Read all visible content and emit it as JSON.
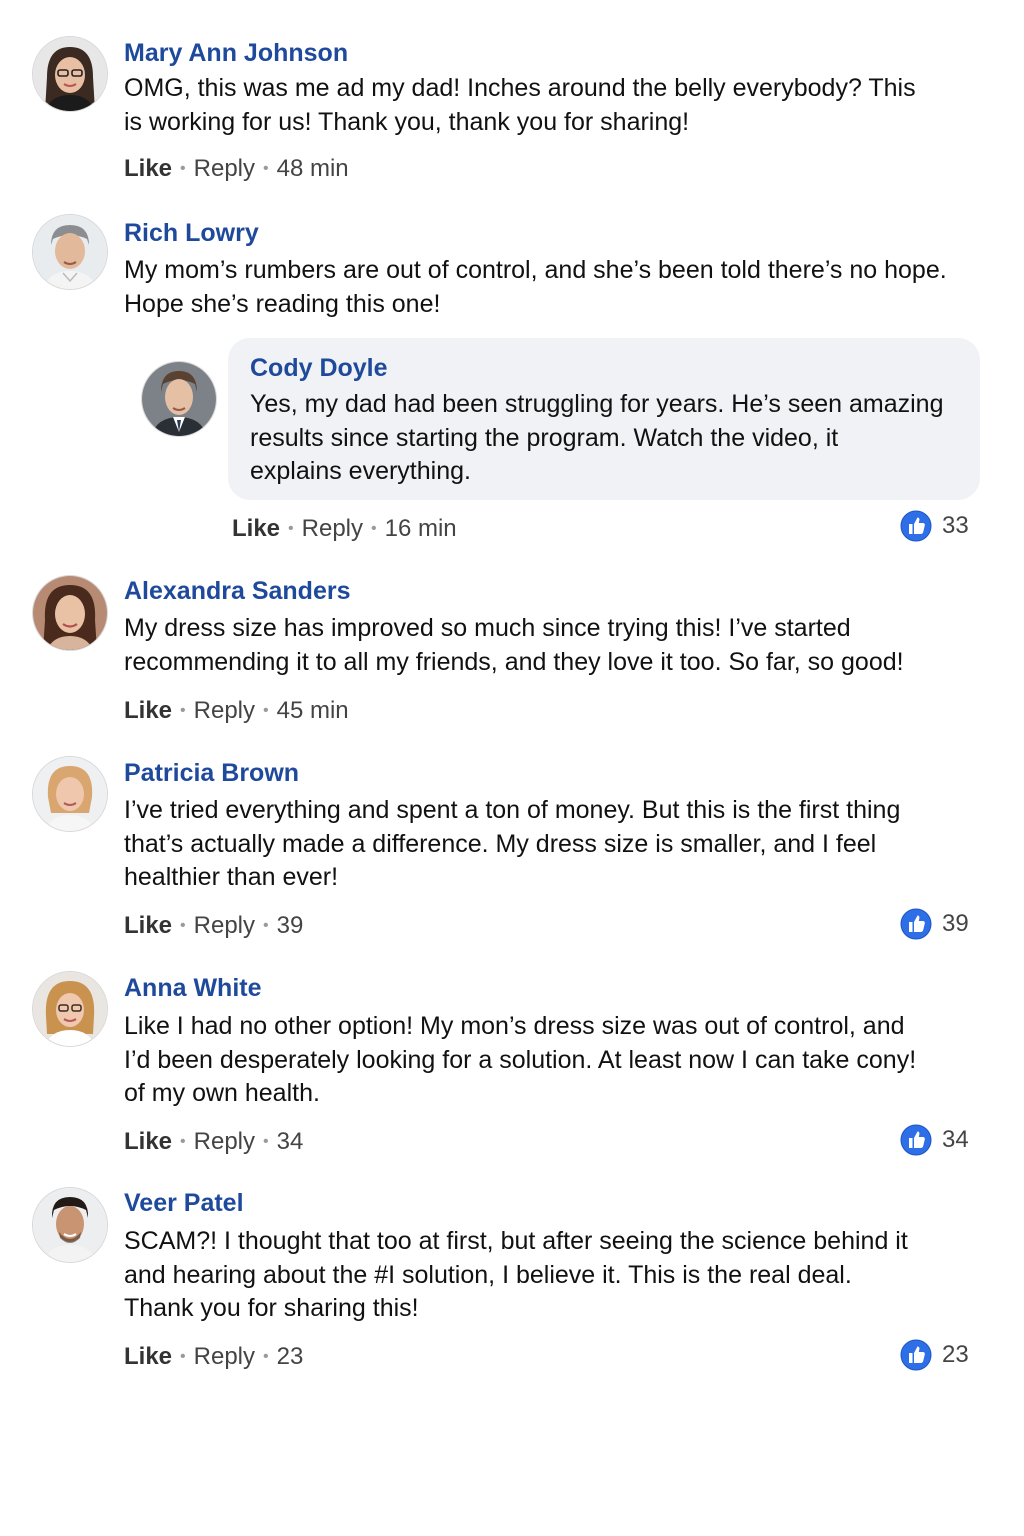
{
  "accent_colors": {
    "name": "#1f4a9c",
    "reaction": "#2e6ee6",
    "bubble": "#f0f2f5"
  },
  "comments": [
    {
      "name": "Mary Ann Johnson",
      "text": "OMG, this was me ad my dad! Inches around the belly everybody? This\nis working for us! Thank you, thank you for sharing!",
      "like": "Like",
      "reply": "Reply",
      "time": "48 min"
    },
    {
      "name": "Rich Lowry",
      "text": "My mom’s rumbers are out of control, and she’s been told there’s no hope.\nHope she’s reading this one!"
    },
    {
      "name": "Cody Doyle",
      "text": "Yes, my dad had been struggling for years. He’s seen amazing\nresults since starting the program. Watch the video, it\nexplains everything.",
      "like": "Like",
      "reply": "Reply",
      "time": "16 min",
      "reactions": "33",
      "reaction_icon": "thumbs-up-icon"
    },
    {
      "name": "Alexandra Sanders",
      "text": "My dress size has improved so much since trying this! I’ve started\nrecommending it to all my friends, and they love it too. So far, so good!",
      "like": "Like",
      "reply": "Reply",
      "time": "45 min"
    },
    {
      "name": "Patricia Brown",
      "text": "I’ve tried everything and spent a ton of money. But this is the first thing\nthat’s actually made a difference. My dress size is smaller, and I feel\nhealthier than ever!",
      "like": "Like",
      "reply": "Reply",
      "time": "39",
      "reactions": "39",
      "reaction_icon": "thumbs-up-icon"
    },
    {
      "name": "Anna White",
      "text": "Like I had no other option! My mon’s dress size was out of control, and\nI’d been desperately looking for a solution. At least now I can take cony!\nof my own health.",
      "like": "Like",
      "reply": "Reply",
      "time": "34",
      "reactions": "34",
      "reaction_icon": "thumbs-up-icon"
    },
    {
      "name": "Veer Patel",
      "text": "SCAM?! I thought that too at first, but after seeing the science behind it\nand hearing about the #I solution, I believe it. This is the real deal.\nThank you for sharing this!",
      "like": "Like",
      "reply": "Reply",
      "time": "23",
      "reactions": "23",
      "reaction_icon": "thumbs-up-icon"
    }
  ]
}
